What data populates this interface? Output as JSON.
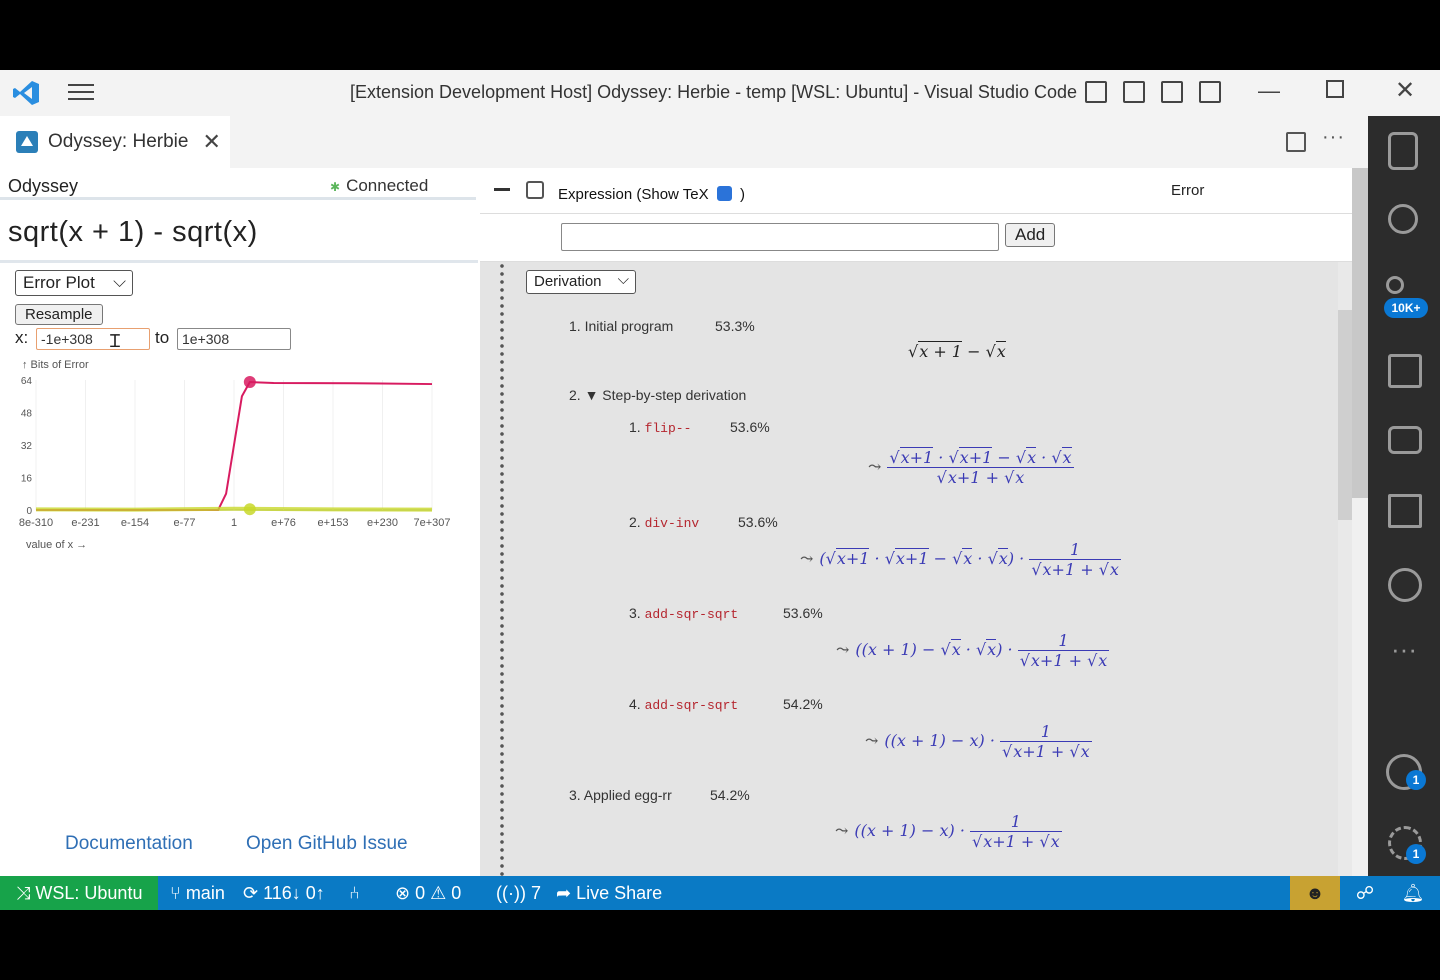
{
  "window": {
    "title": "[Extension Development Host] Odyssey: Herbie - temp [WSL: Ubuntu] - Visual Studio Code"
  },
  "tab": {
    "label": "Odyssey: Herbie"
  },
  "odyssey": {
    "title": "Odyssey",
    "status": "Connected",
    "expression": "sqrt(x + 1) - sqrt(x)",
    "view_select": "Error Plot",
    "resample_label": "Resample",
    "x_label": "x:",
    "to_label": "to",
    "x_from": "-1e+308",
    "x_to": "1e+308",
    "links": {
      "docs": "Documentation",
      "issue": "Open GitHub Issue"
    }
  },
  "chart_data": {
    "type": "scatter",
    "ylabel": "↑ Bits of Error",
    "xlabel": "value of x →",
    "ylim": [
      0,
      64
    ],
    "yticks": [
      "64",
      "48",
      "32",
      "16",
      "0"
    ],
    "xticks": [
      "8e-310",
      "e-231",
      "e-154",
      "e-77",
      "1",
      "e+76",
      "e+153",
      "e+230",
      "7e+307"
    ],
    "series": [
      {
        "color": "#d81b60",
        "values": [
          [
            0,
            0
          ],
          [
            0.46,
            0
          ],
          [
            0.48,
            8
          ],
          [
            0.5,
            32
          ],
          [
            0.52,
            56
          ],
          [
            0.54,
            63
          ],
          [
            0.6,
            62.5
          ],
          [
            0.8,
            62.4
          ],
          [
            1.0,
            62
          ]
        ]
      },
      {
        "color": "#c8d82a",
        "values": [
          [
            0,
            0.3
          ],
          [
            0.25,
            0.2
          ],
          [
            0.5,
            0.6
          ],
          [
            0.75,
            0.3
          ],
          [
            1.0,
            0.2
          ]
        ]
      }
    ],
    "markers": [
      {
        "color": "#d81b60",
        "x": 0.54,
        "y": 63
      },
      {
        "color": "#c8d82a",
        "x": 0.54,
        "y": 0.4
      }
    ]
  },
  "right": {
    "expression_label": "Expression (Show TeX",
    "expression_close": ")",
    "error_label": "Error",
    "add_label": "Add",
    "derivation_select": "Derivation",
    "steps": {
      "s1": {
        "label": "1. Initial program",
        "pct": "53.3%"
      },
      "s2": {
        "label": "2. ▼ Step-by-step derivation"
      },
      "s21": {
        "num": "1.",
        "rule": "flip--",
        "pct": "53.6%"
      },
      "s22": {
        "num": "2.",
        "rule": "div-inv",
        "pct": "53.6%"
      },
      "s23": {
        "num": "3.",
        "rule": "add-sqr-sqrt",
        "pct": "53.6%"
      },
      "s24": {
        "num": "4.",
        "rule": "add-sqr-sqrt",
        "pct": "54.2%"
      },
      "s3": {
        "label": "3. Applied egg-rr",
        "pct": "54.2%"
      }
    }
  },
  "statusbar": {
    "remote": "WSL: Ubuntu",
    "branch": "main",
    "sync": "116↓ 0↑",
    "errors": "0",
    "warnings": "0",
    "ports": "7",
    "liveshare": "Live Share"
  },
  "activity": {
    "scm_badge": "10K+",
    "accounts_badge": "1",
    "settings_badge": "1"
  }
}
